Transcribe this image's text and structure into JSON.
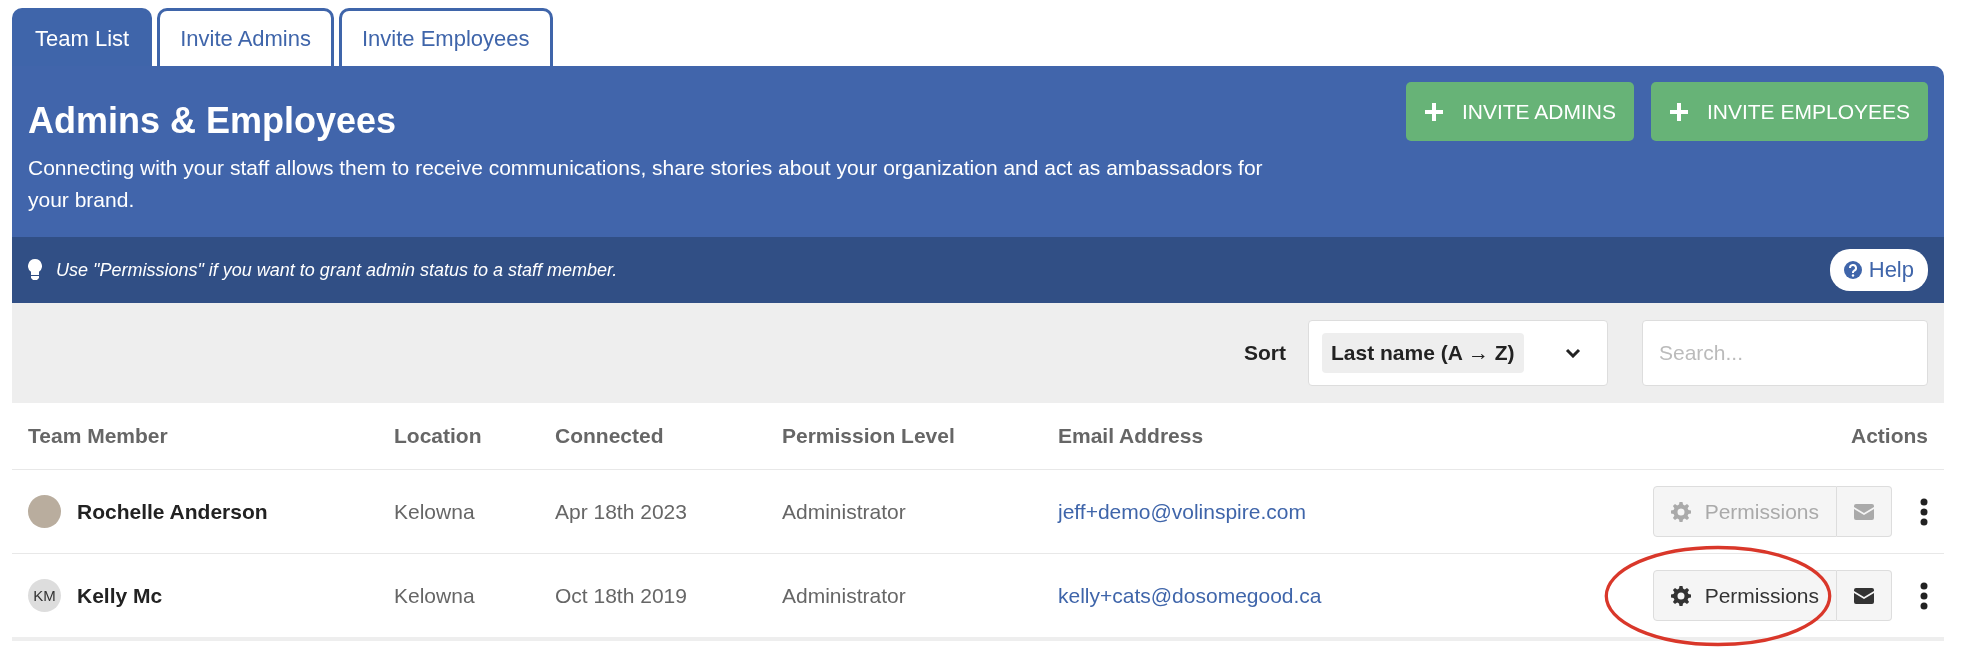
{
  "tabs": [
    {
      "label": "Team List",
      "selected": true
    },
    {
      "label": "Invite Admins",
      "selected": false
    },
    {
      "label": "Invite Employees",
      "selected": false
    }
  ],
  "header": {
    "title": "Admins & Employees",
    "description": "Connecting with your staff allows them to receive communications, share stories about your organization and act as ambassadors for your brand.",
    "buttons": [
      "INVITE ADMINS",
      "INVITE EMPLOYEES"
    ]
  },
  "tip": {
    "text": "Use \"Permissions\" if you want to grant admin status to a staff member.",
    "help_label": "Help"
  },
  "toolbar": {
    "sort_label": "Sort",
    "sort_value": "Last name (A → Z)",
    "search": {
      "placeholder": "Search..."
    }
  },
  "table": {
    "columns": [
      "Team Member",
      "Location",
      "Connected",
      "Permission Level",
      "Email Address",
      "Actions"
    ],
    "rows": [
      {
        "avatar": {
          "kind": "photo"
        },
        "name": "Rochelle Anderson",
        "location": "Kelowna",
        "connected": "Apr 18th 2023",
        "permission": "Administrator",
        "email": "jeff+demo@volinspire.com",
        "permissions_button": {
          "label": "Permissions",
          "disabled": true
        },
        "circled": false
      },
      {
        "avatar": {
          "kind": "initials",
          "text": "KM"
        },
        "name": "Kelly Mc",
        "location": "Kelowna",
        "connected": "Oct 18th 2019",
        "permission": "Administrator",
        "email": "kelly+cats@dosomegood.ca",
        "permissions_button": {
          "label": "Permissions",
          "disabled": false
        },
        "circled": true
      }
    ]
  }
}
